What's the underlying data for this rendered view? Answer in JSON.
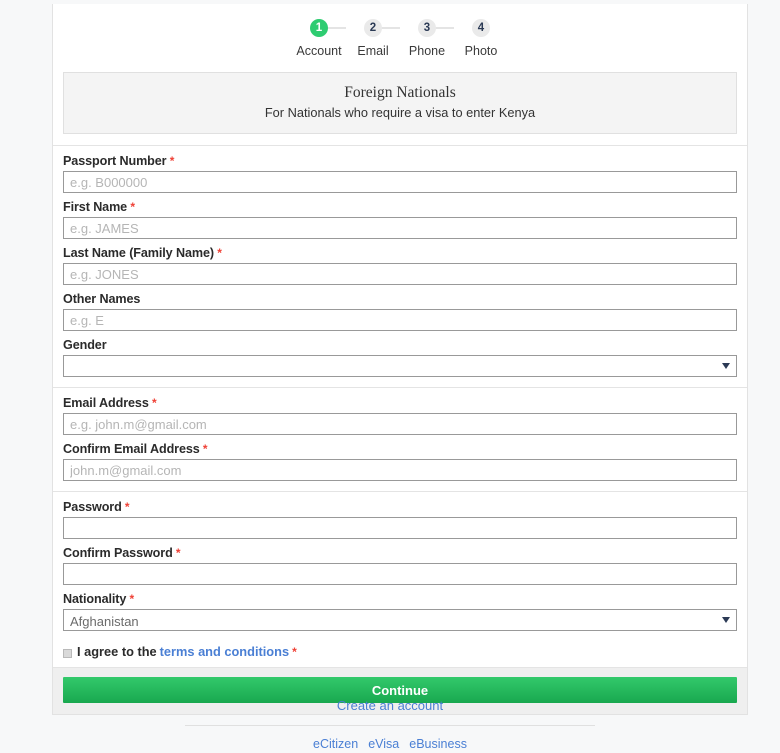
{
  "stepper": {
    "steps": [
      {
        "number": "1",
        "label": "Account",
        "active": true
      },
      {
        "number": "2",
        "label": "Email",
        "active": false
      },
      {
        "number": "3",
        "label": "Phone",
        "active": false
      },
      {
        "number": "4",
        "label": "Photo",
        "active": false
      }
    ]
  },
  "banner": {
    "title": "Foreign Nationals",
    "subtitle": "For Nationals who require a visa to enter Kenya"
  },
  "form": {
    "sections": [
      {
        "name": "identity",
        "fields": [
          {
            "label": "Passport Number",
            "required": true,
            "type": "text",
            "placeholder": "e.g. B000000",
            "value": ""
          },
          {
            "label": "First Name",
            "required": true,
            "type": "text",
            "placeholder": "e.g. JAMES",
            "value": ""
          },
          {
            "label": "Last Name (Family Name)",
            "required": true,
            "type": "text",
            "placeholder": "e.g. JONES",
            "value": ""
          },
          {
            "label": "Other Names",
            "required": false,
            "type": "text",
            "placeholder": "e.g. E",
            "value": ""
          },
          {
            "label": "Gender",
            "required": false,
            "type": "select",
            "selected": ""
          }
        ]
      },
      {
        "name": "email",
        "fields": [
          {
            "label": "Email Address",
            "required": true,
            "type": "text",
            "placeholder": "e.g. john.m@gmail.com",
            "value": ""
          },
          {
            "label": "Confirm Email Address",
            "required": true,
            "type": "text",
            "placeholder": "john.m@gmail.com",
            "value": ""
          }
        ]
      },
      {
        "name": "credentials",
        "fields": [
          {
            "label": "Password",
            "required": true,
            "type": "password",
            "placeholder": "",
            "value": ""
          },
          {
            "label": "Confirm Password",
            "required": true,
            "type": "password",
            "placeholder": "",
            "value": ""
          },
          {
            "label": "Nationality",
            "required": true,
            "type": "select",
            "selected": "Afghanistan"
          }
        ]
      }
    ],
    "terms": {
      "prefix": "I agree to the",
      "link": "terms and conditions",
      "required_mark": "*",
      "checked": false
    },
    "submit_label": "Continue"
  },
  "footer": {
    "create_account": "Create an account",
    "links": [
      "eCitizen",
      "eVisa",
      "eBusiness"
    ]
  },
  "colors": {
    "accent_green": "#2ecc71",
    "required_red": "#ef4136",
    "link_blue": "#4a7fd4",
    "step_inactive": "#eaeaea"
  }
}
